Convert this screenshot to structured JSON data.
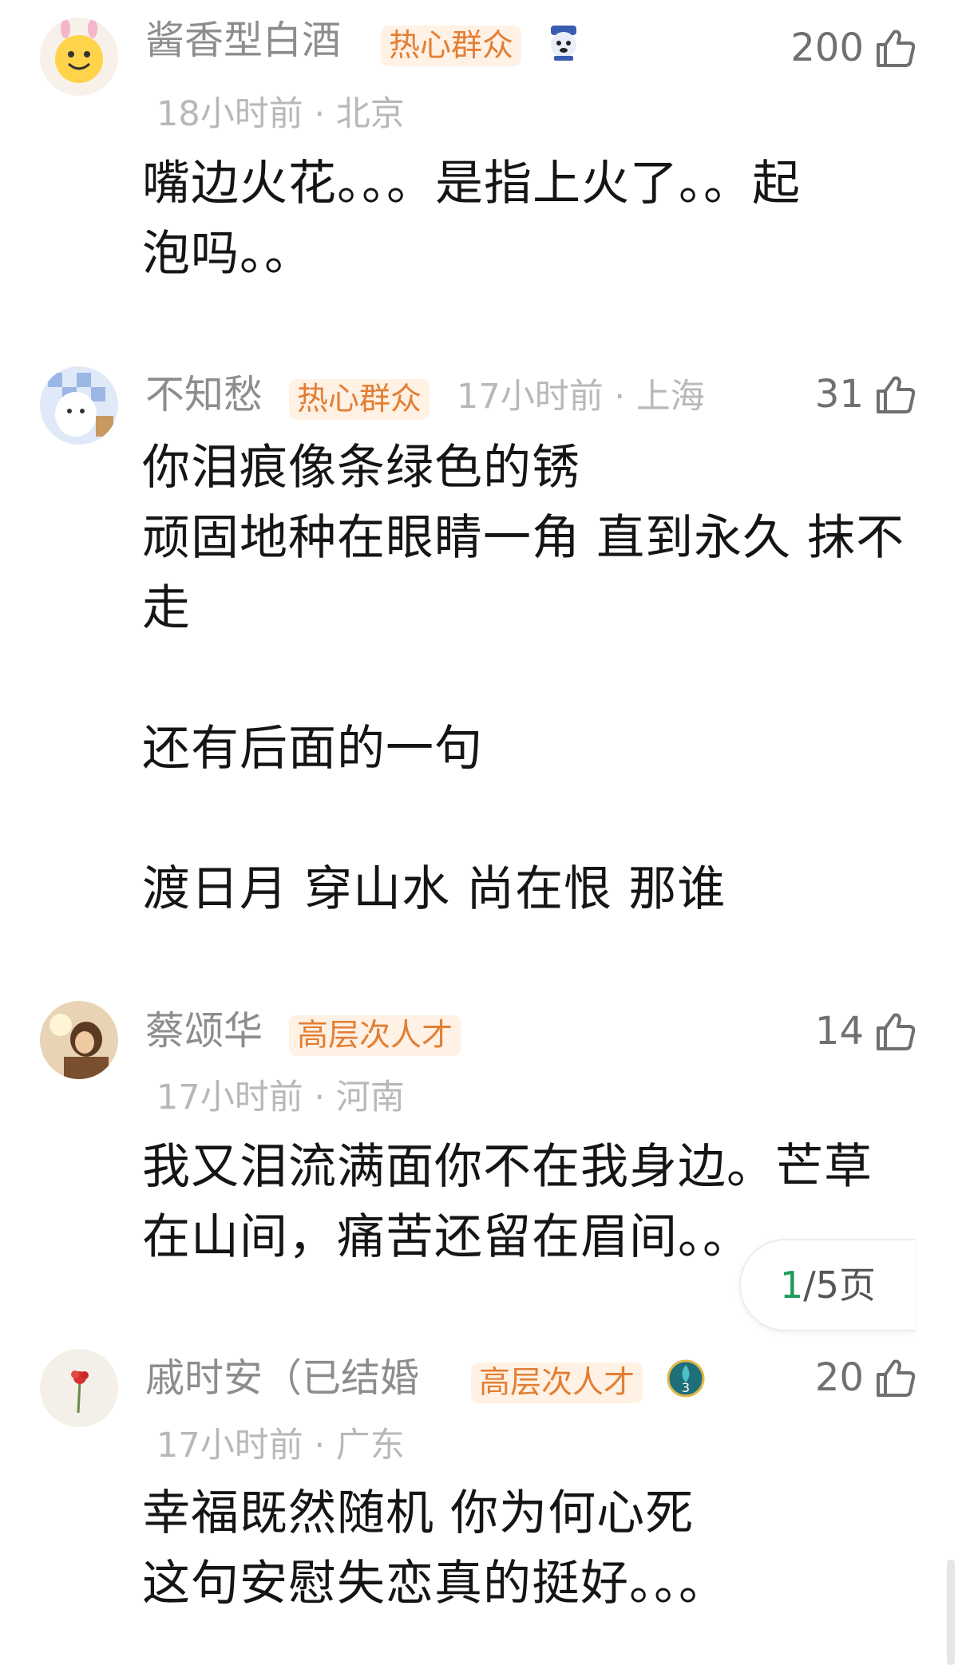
{
  "comments": [
    {
      "name": "酱香型白酒",
      "badge": "热心群众",
      "meta": "18小时前 · 北京",
      "likes": "200",
      "text": "嘴边火花。。。是指上火了。。起\n泡吗。。",
      "avatar_icon": "smiley-avatar-icon",
      "extra_icon": "dog-sticker-icon"
    },
    {
      "name": "不知愁",
      "badge": "热心群众",
      "meta": "17小时前 · 上海",
      "likes": "31",
      "text": "你泪痕像条绿色的锈\n顽固地种在眼睛一角 直到永久 抹不\n走\n\n还有后面的一句\n\n渡日月 穿山水 尚在恨 那谁",
      "avatar_icon": "cartoon-avatar-icon"
    },
    {
      "name": "蔡颂华",
      "badge": "高层次人才",
      "meta": "17小时前 · 河南",
      "likes": "14",
      "text": "我又泪流满面你不在我身边。芒草\n在山间，痛苦还留在眉间。。",
      "avatar_icon": "photo-avatar-icon"
    },
    {
      "name": "戚时安（已结婚",
      "badge": "高层次人才",
      "meta": "17小时前 · 广东",
      "likes": "20",
      "text": "幸福既然随机 你为何心死\n这句安慰失恋真的挺好。。。",
      "avatar_icon": "flower-avatar-icon",
      "level_badge": "3"
    }
  ],
  "pager": {
    "current": "1",
    "total": "/5页"
  },
  "colors": {
    "badge_text": "#e27f35",
    "badge_bg": "#fff1e4",
    "pager_current": "#1f9a5d"
  },
  "icons": {
    "like": "thumbs-up-icon"
  }
}
